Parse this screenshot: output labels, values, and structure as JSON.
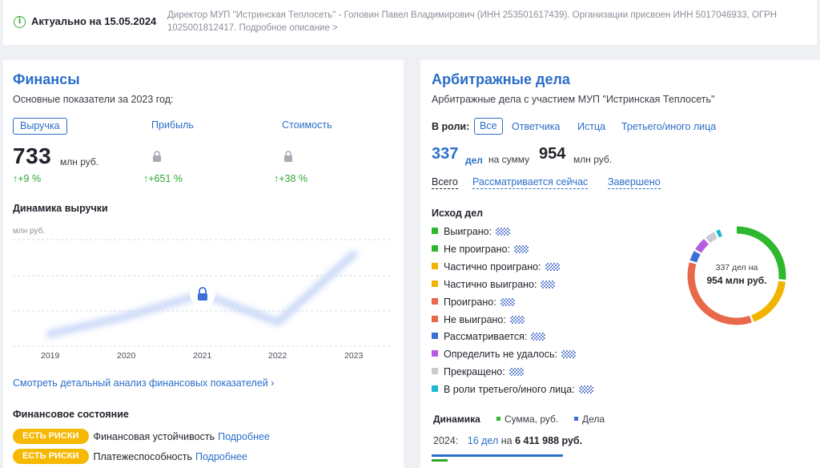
{
  "banner": {
    "actual": "Актуально на 15.05.2024",
    "description": "Директор МУП \"Истринская Теплосеть\" - Головин Павел Владимирович (ИНН 253501617439). Организации присвоен ИНН 5017046933, ОГРН 1025001812417.",
    "more": "Подробное описание >"
  },
  "finance": {
    "title": "Финансы",
    "subtitle": "Основные показатели за 2023 год:",
    "metrics": [
      {
        "label": "Выручка",
        "value": "733",
        "unit": "млн руб.",
        "delta": "↑+9 %"
      },
      {
        "label": "Прибыль",
        "delta": "↑+651 %"
      },
      {
        "label": "Стоимость",
        "delta": "↑+38 %"
      }
    ],
    "dynamics_title": "Динамика выручки",
    "chart_unit": "млн руб.",
    "detail_link": "Смотреть детальный анализ финансовых показателей ›",
    "state_title": "Финансовое состояние",
    "risks": [
      {
        "badge": "ЕСТЬ РИСКИ",
        "text": "Финансовая устойчивость",
        "link": "Подробнее"
      },
      {
        "badge": "ЕСТЬ РИСКИ",
        "text": "Платежеспособность",
        "link": "Подробнее"
      }
    ]
  },
  "chart_data": {
    "type": "line",
    "categories": [
      "2019",
      "2020",
      "2021",
      "2022",
      "2023"
    ],
    "values": [
      null,
      null,
      null,
      null,
      null
    ],
    "note_hidden": true,
    "ylabel": "млн руб.",
    "grid": true,
    "colors": {
      "line": "#c7d6f7",
      "grid": "#d6d9de"
    }
  },
  "arbitration": {
    "title": "Арбитражные дела",
    "subtitle": "Арбитражные дела с участием МУП \"Истринская Теплосеть\"",
    "role_label": "В роли:",
    "roles": [
      "Все",
      "Ответчика",
      "Истца",
      "Третьего/иного лица"
    ],
    "cases_count": "337",
    "cases_word": "дел",
    "sum_word": "на сумму",
    "sum_value": "954",
    "sum_unit": "млн руб.",
    "filters": [
      "Всего",
      "Рассматривается сейчас",
      "Завершено"
    ],
    "outcomes_title": "Исход дел",
    "outcomes": [
      {
        "label": "Выиграно:",
        "color": "#2db82d"
      },
      {
        "label": "Не проиграно:",
        "color": "#2db82d"
      },
      {
        "label": "Частично проиграно:",
        "color": "#f0b400"
      },
      {
        "label": "Частично выиграно:",
        "color": "#f0b400"
      },
      {
        "label": "Проиграно:",
        "color": "#e8694a"
      },
      {
        "label": "Не выиграно:",
        "color": "#e8694a"
      },
      {
        "label": "Рассматривается:",
        "color": "#3a6fd8"
      },
      {
        "label": "Определить не удалось:",
        "color": "#b65ce0"
      },
      {
        "label": "Прекращено:",
        "color": "#c9cbcf"
      },
      {
        "label": "В роли третьего/иного лица:",
        "color": "#1fb8d6"
      }
    ],
    "donut_cases": "337 дел на",
    "donut_sum": "954 млн руб.",
    "donut_segments": [
      {
        "name": "green",
        "color": "#2db82d",
        "fraction": 0.27
      },
      {
        "name": "yellow",
        "color": "#f0b400",
        "fraction": 0.18
      },
      {
        "name": "red",
        "color": "#e8694a",
        "fraction": 0.35
      },
      {
        "name": "blue",
        "color": "#3a6fd8",
        "fraction": 0.04
      },
      {
        "name": "purple",
        "color": "#b65ce0",
        "fraction": 0.05
      },
      {
        "name": "gray",
        "color": "#c9cbcf",
        "fraction": 0.04
      },
      {
        "name": "cyan",
        "color": "#1fb8d6",
        "fraction": 0.02
      }
    ],
    "dynamics_title": "Динамика",
    "legend_sum": "Сумма, руб.",
    "legend_cases": "Дела",
    "year_label": "2024:",
    "year_cases": "16 дел",
    "year_on": "на",
    "year_amount": "6 411 988 руб."
  }
}
